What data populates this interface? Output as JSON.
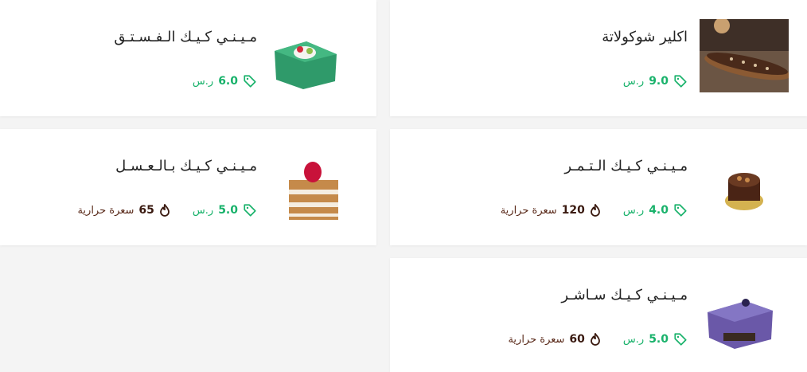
{
  "items": [
    {
      "name": "اكلير شوكولاتة",
      "price": "9.0",
      "currency": "ر.س",
      "calories": null,
      "calories_label": null,
      "image_icon": "chocolate-eclair"
    },
    {
      "name": "مـيـنـي كـيـك الـفـسـتـق",
      "price": "6.0",
      "currency": "ر.س",
      "calories": null,
      "calories_label": null,
      "image_icon": "pistachio-cake"
    },
    {
      "name": "مـيـنـي كـيـك الـتـمـر",
      "price": "4.0",
      "currency": "ر.س",
      "calories": "120",
      "calories_label": "سعرة حرارية",
      "image_icon": "date-cake"
    },
    {
      "name": "مـيـنـي كـيـك بـالـعـسـل",
      "price": "5.0",
      "currency": "ر.س",
      "calories": "65",
      "calories_label": "سعرة حرارية",
      "image_icon": "honey-cake"
    },
    {
      "name": "مـيـنـي كـيـك سـاشـر",
      "price": "5.0",
      "currency": "ر.س",
      "calories": "60",
      "calories_label": "سعرة حرارية",
      "image_icon": "sacher-cake"
    }
  ],
  "colors": {
    "price": "#19b26b",
    "calorie": "#5a2a1a"
  }
}
